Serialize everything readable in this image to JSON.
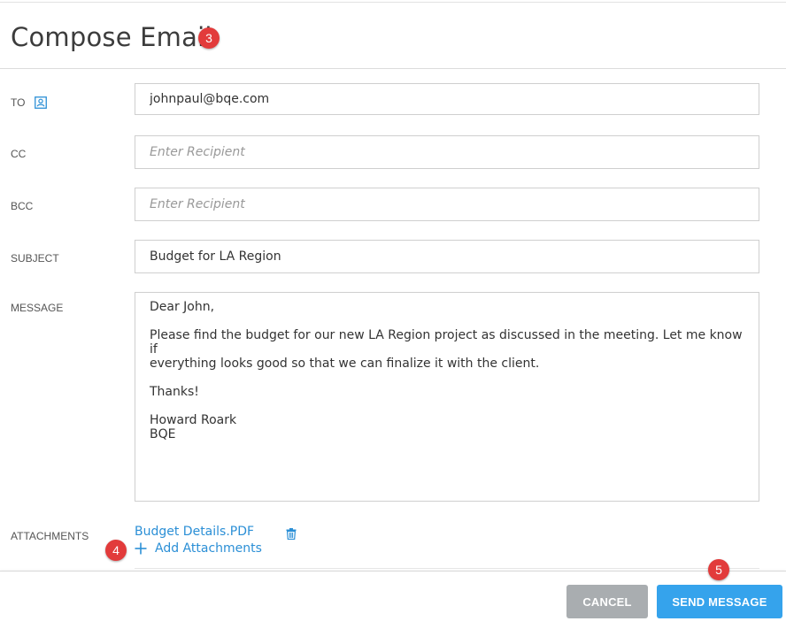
{
  "header": {
    "title": "Compose Email",
    "badge_title": "3"
  },
  "form": {
    "to": {
      "label": "TO",
      "value": "johnpaul@bqe.com",
      "placeholder": "Enter Recipient"
    },
    "cc": {
      "label": "CC",
      "value": "",
      "placeholder": "Enter Recipient"
    },
    "bcc": {
      "label": "BCC",
      "value": "",
      "placeholder": "Enter Recipient"
    },
    "subject": {
      "label": "SUBJECT",
      "value": "Budget for LA Region"
    },
    "message": {
      "label": "MESSAGE",
      "value": "Dear John,\n\nPlease find the budget for our new LA Region project as discussed in the meeting. Let me know if\neverything looks good so that we can finalize it with the client.\n\nThanks!\n\nHoward Roark\nBQE"
    },
    "attachments": {
      "label": "ATTACHMENTS",
      "files": [
        "Budget Details.PDF"
      ],
      "add_label": "Add Attachments",
      "badge": "4"
    }
  },
  "footer": {
    "cancel_label": "CANCEL",
    "send_label": "SEND MESSAGE",
    "badge": "5"
  },
  "colors": {
    "accent": "#35a3ec",
    "link": "#2b8fd6",
    "badge": "#e23b3b",
    "cancel": "#a9adb0"
  },
  "icons": {
    "contact": "contact-book-icon",
    "trash": "trash-icon",
    "plus": "plus-icon"
  }
}
